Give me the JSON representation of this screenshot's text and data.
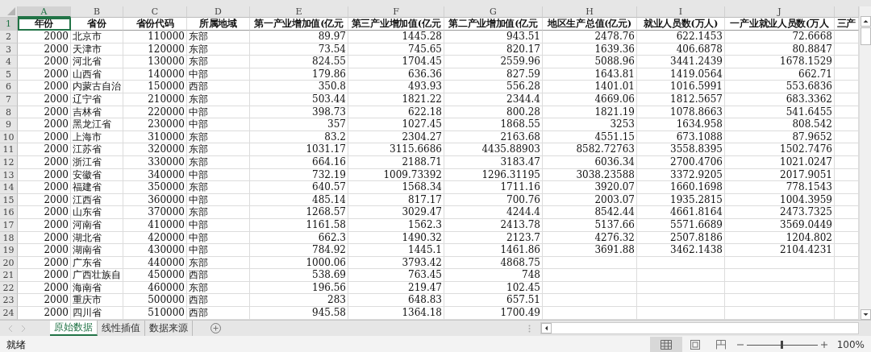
{
  "sheet": {
    "column_letters": [
      {
        "letter": "A",
        "selected": true
      },
      {
        "letter": "B",
        "selected": false
      },
      {
        "letter": "C",
        "selected": false
      },
      {
        "letter": "D",
        "selected": false
      },
      {
        "letter": "E",
        "selected": false
      },
      {
        "letter": "F",
        "selected": false
      },
      {
        "letter": "G",
        "selected": false
      },
      {
        "letter": "H",
        "selected": false
      },
      {
        "letter": "I",
        "selected": false
      },
      {
        "letter": "J",
        "selected": false
      }
    ],
    "header_row": {
      "number": "1",
      "selected": true,
      "cells": [
        {
          "text": "年份",
          "selected": true
        },
        {
          "text": "省份",
          "selected": false
        },
        {
          "text": "省份代码",
          "selected": false
        },
        {
          "text": "所属地域",
          "selected": false
        },
        {
          "text": "第一产业增加值(亿元",
          "selected": false
        },
        {
          "text": "第三产业增加值(亿元",
          "selected": false
        },
        {
          "text": "第二产业增加值(亿元",
          "selected": false
        },
        {
          "text": "地区生产总值(亿元)",
          "selected": false
        },
        {
          "text": "就业人员数(万人)",
          "selected": false
        },
        {
          "text": "一产业就业人员数(万人",
          "selected": false
        },
        {
          "text": "三产",
          "selected": false
        }
      ]
    },
    "rows": [
      {
        "number": "2",
        "cells": [
          "2000",
          "北京市",
          "110000",
          "东部",
          "89.97",
          "1445.28",
          "943.51",
          "2478.76",
          "622.1453",
          "72.6668"
        ]
      },
      {
        "number": "3",
        "cells": [
          "2000",
          "天津市",
          "120000",
          "东部",
          "73.54",
          "745.65",
          "820.17",
          "1639.36",
          "406.6878",
          "80.8847"
        ]
      },
      {
        "number": "4",
        "cells": [
          "2000",
          "河北省",
          "130000",
          "东部",
          "824.55",
          "1704.45",
          "2559.96",
          "5088.96",
          "3441.2439",
          "1678.1529"
        ]
      },
      {
        "number": "5",
        "cells": [
          "2000",
          "山西省",
          "140000",
          "中部",
          "179.86",
          "636.36",
          "827.59",
          "1643.81",
          "1419.0564",
          "662.71"
        ]
      },
      {
        "number": "6",
        "cells": [
          "2000",
          "内蒙古自治",
          "150000",
          "西部",
          "350.8",
          "493.93",
          "556.28",
          "1401.01",
          "1016.5991",
          "553.6836"
        ]
      },
      {
        "number": "7",
        "cells": [
          "2000",
          "辽宁省",
          "210000",
          "东部",
          "503.44",
          "1821.22",
          "2344.4",
          "4669.06",
          "1812.5657",
          "683.3362"
        ]
      },
      {
        "number": "8",
        "cells": [
          "2000",
          "吉林省",
          "220000",
          "中部",
          "398.73",
          "622.18",
          "800.28",
          "1821.19",
          "1078.8663",
          "541.6455"
        ]
      },
      {
        "number": "9",
        "cells": [
          "2000",
          "黑龙江省",
          "230000",
          "中部",
          "357",
          "1027.45",
          "1868.55",
          "3253",
          "1634.958",
          "808.542"
        ]
      },
      {
        "number": "10",
        "cells": [
          "2000",
          "上海市",
          "310000",
          "东部",
          "83.2",
          "2304.27",
          "2163.68",
          "4551.15",
          "673.1088",
          "87.9652"
        ]
      },
      {
        "number": "11",
        "cells": [
          "2000",
          "江苏省",
          "320000",
          "东部",
          "1031.17",
          "3115.6686",
          "4435.88903",
          "8582.72763",
          "3558.8395",
          "1502.7476"
        ]
      },
      {
        "number": "12",
        "cells": [
          "2000",
          "浙江省",
          "330000",
          "东部",
          "664.16",
          "2188.71",
          "3183.47",
          "6036.34",
          "2700.4706",
          "1021.0247"
        ]
      },
      {
        "number": "13",
        "cells": [
          "2000",
          "安徽省",
          "340000",
          "中部",
          "732.19",
          "1009.73392",
          "1296.31195",
          "3038.23588",
          "3372.9205",
          "2017.9051"
        ]
      },
      {
        "number": "14",
        "cells": [
          "2000",
          "福建省",
          "350000",
          "东部",
          "640.57",
          "1568.34",
          "1711.16",
          "3920.07",
          "1660.1698",
          "778.1543"
        ]
      },
      {
        "number": "15",
        "cells": [
          "2000",
          "江西省",
          "360000",
          "中部",
          "485.14",
          "817.17",
          "700.76",
          "2003.07",
          "1935.2815",
          "1004.3959"
        ]
      },
      {
        "number": "16",
        "cells": [
          "2000",
          "山东省",
          "370000",
          "东部",
          "1268.57",
          "3029.47",
          "4244.4",
          "8542.44",
          "4661.8164",
          "2473.7325"
        ]
      },
      {
        "number": "17",
        "cells": [
          "2000",
          "河南省",
          "410000",
          "中部",
          "1161.58",
          "1562.3",
          "2413.78",
          "5137.66",
          "5571.6689",
          "3569.0449"
        ]
      },
      {
        "number": "18",
        "cells": [
          "2000",
          "湖北省",
          "420000",
          "中部",
          "662.3",
          "1490.32",
          "2123.7",
          "4276.32",
          "2507.8186",
          "1204.802"
        ]
      },
      {
        "number": "19",
        "cells": [
          "2000",
          "湖南省",
          "430000",
          "中部",
          "784.92",
          "1445.1",
          "1461.86",
          "3691.88",
          "3462.1438",
          "2104.4231"
        ]
      },
      {
        "number": "20",
        "cells": [
          "2000",
          "广东省",
          "440000",
          "东部",
          "1000.06",
          "3793.42",
          "4868.75"
        ]
      },
      {
        "number": "21",
        "cells": [
          "2000",
          "广西壮族自",
          "450000",
          "西部",
          "538.69",
          "763.45",
          "748"
        ]
      },
      {
        "number": "22",
        "cells": [
          "2000",
          "海南省",
          "460000",
          "东部",
          "196.56",
          "219.47",
          "102.45"
        ]
      },
      {
        "number": "23",
        "cells": [
          "2000",
          "重庆市",
          "500000",
          "西部",
          "283",
          "648.83",
          "657.51"
        ]
      },
      {
        "number": "24",
        "cells": [
          "2000",
          "四川省",
          "510000",
          "西部",
          "945.58",
          "1364.18",
          "1700.49"
        ]
      }
    ]
  },
  "sheet_tabs": [
    {
      "label": "原始数据",
      "selected": true
    },
    {
      "label": "线性插值",
      "selected": false
    },
    {
      "label": "数据来源",
      "selected": false
    }
  ],
  "status_bar": {
    "status": "就绪",
    "zoom": {
      "level": 0.5,
      "reading": "100%"
    }
  }
}
